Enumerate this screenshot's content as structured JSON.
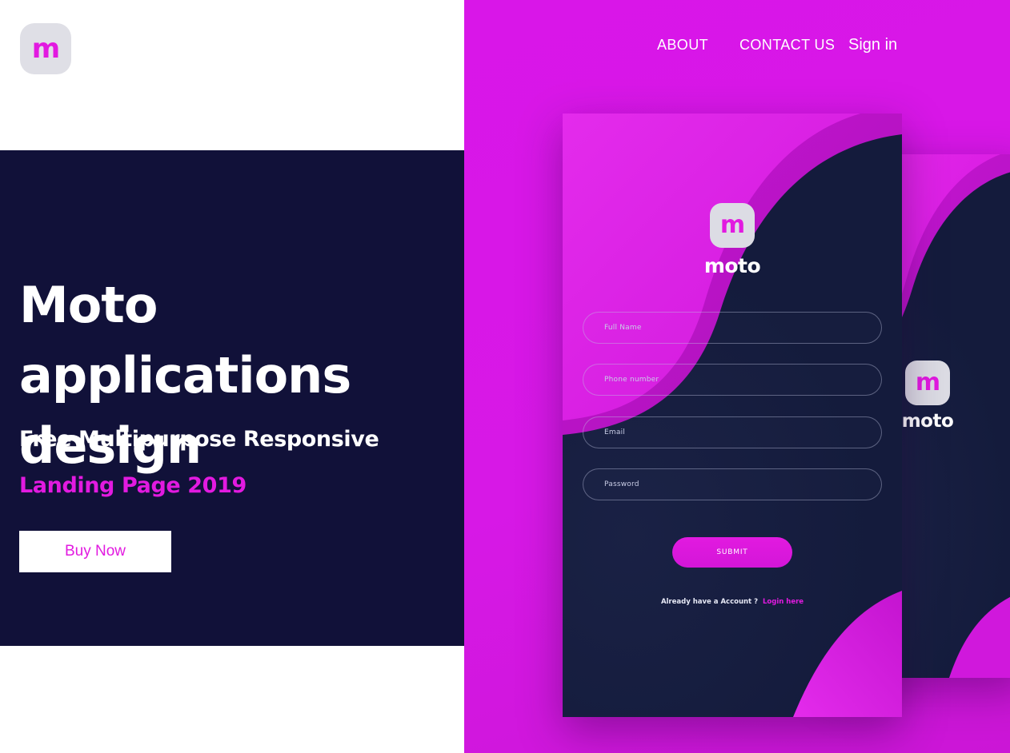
{
  "brand": {
    "logo_letter": "m",
    "logo_bg": "#dfdfe6",
    "logo_color": "#e21ae0",
    "wordmark": "moto"
  },
  "colors": {
    "magenta": "#d916e8",
    "dark_navy": "#111139",
    "phone_navy": "#141b3c",
    "white": "#ffffff"
  },
  "nav": {
    "about": "ABOUT",
    "contact": "CONTACT US",
    "signin": "Sign in"
  },
  "hero": {
    "title": "Moto applications design",
    "subtitle_white": "Free Multipurpose Responsive",
    "subtitle_accent": "Landing Page 2019",
    "cta_label": "Buy Now"
  },
  "phone_front": {
    "wordmark": "moto",
    "logo_letter": "m",
    "fields": [
      {
        "placeholder": "Full Name"
      },
      {
        "placeholder": "Phone number"
      },
      {
        "placeholder": "Email"
      },
      {
        "placeholder": "Password"
      }
    ],
    "submit_label": "SUBMIT",
    "login_prompt": "Already have a Account ?",
    "login_link": "Login here"
  },
  "phone_back": {
    "wordmark": "moto",
    "logo_letter": "m"
  }
}
